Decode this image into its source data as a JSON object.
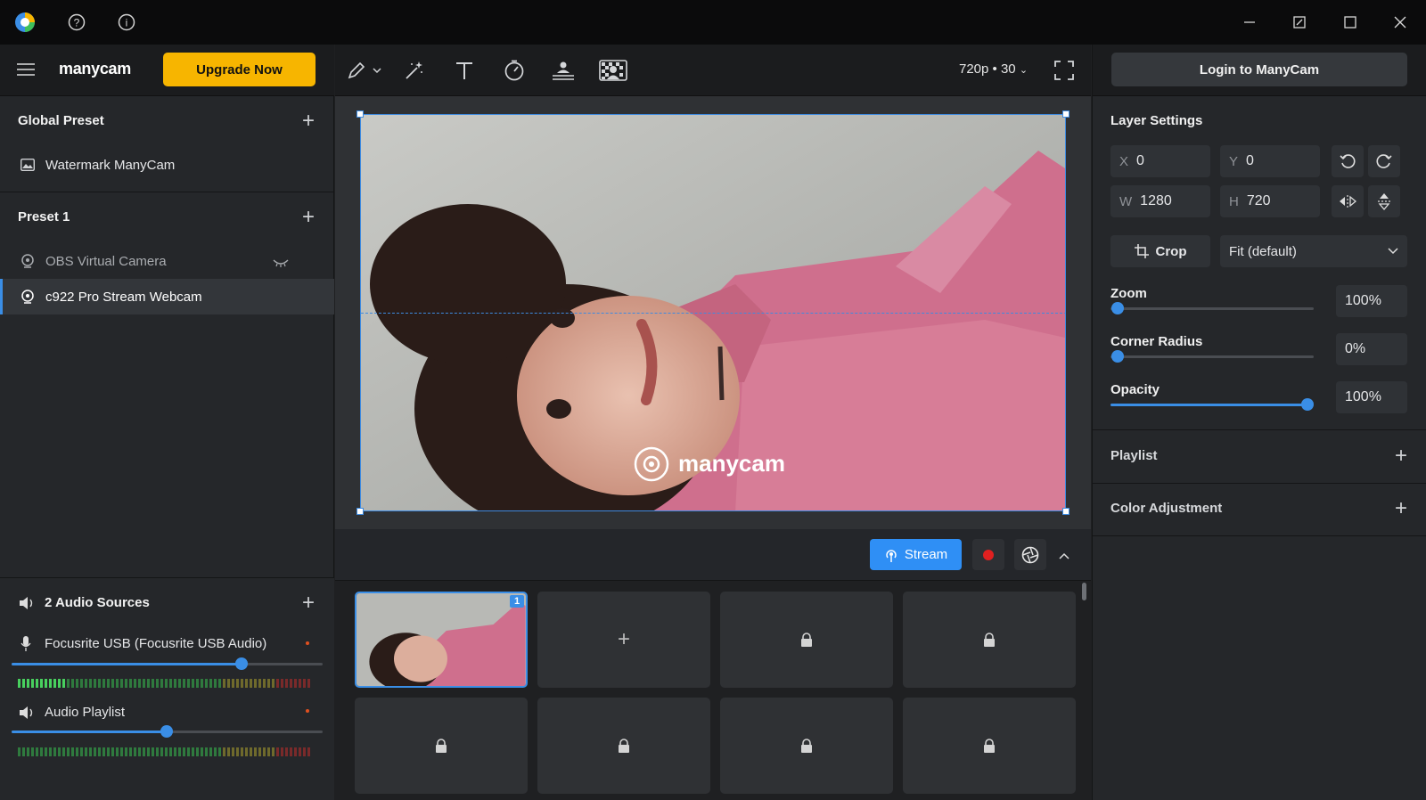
{
  "titlebar": {
    "help": "?",
    "info": "i"
  },
  "brand": {
    "logo": "manycam",
    "upgrade": "Upgrade Now"
  },
  "left": {
    "global_preset": {
      "title": "Global Preset",
      "items": [
        {
          "label": "Watermark ManyCam",
          "icon": "image-icon"
        }
      ]
    },
    "preset1": {
      "title": "Preset 1",
      "items": [
        {
          "label": "OBS Virtual Camera",
          "icon": "webcam-icon"
        },
        {
          "label": "c922 Pro Stream Webcam",
          "icon": "webcam-icon"
        }
      ]
    },
    "audio": {
      "title": "2 Audio Sources",
      "sources": [
        {
          "label": "Focusrite USB (Focusrite USB Audio)",
          "level": 0.75
        },
        {
          "label": "Audio Playlist",
          "level": 0.5
        }
      ]
    }
  },
  "toolbar": {
    "resolution": "720p • 30"
  },
  "preview": {
    "watermark": "manycam"
  },
  "controls": {
    "stream": "Stream"
  },
  "scenes": {
    "badge": "1"
  },
  "right": {
    "login": "Login to ManyCam",
    "layer_settings": "Layer Settings",
    "x": {
      "k": "X",
      "v": "0"
    },
    "y": {
      "k": "Y",
      "v": "0"
    },
    "w": {
      "k": "W",
      "v": "1280"
    },
    "h": {
      "k": "H",
      "v": "720"
    },
    "crop": "Crop",
    "fit": "Fit (default)",
    "zoom": {
      "label": "Zoom",
      "value": "100%",
      "level": 0
    },
    "corner": {
      "label": "Corner Radius",
      "value": "0%",
      "level": 0
    },
    "opacity": {
      "label": "Opacity",
      "value": "100%",
      "level": 1
    },
    "playlist": "Playlist",
    "color": "Color Adjustment"
  },
  "colors": {
    "accent": "#2f8ff5",
    "upgrade": "#f7b500",
    "record": "#e02020"
  }
}
